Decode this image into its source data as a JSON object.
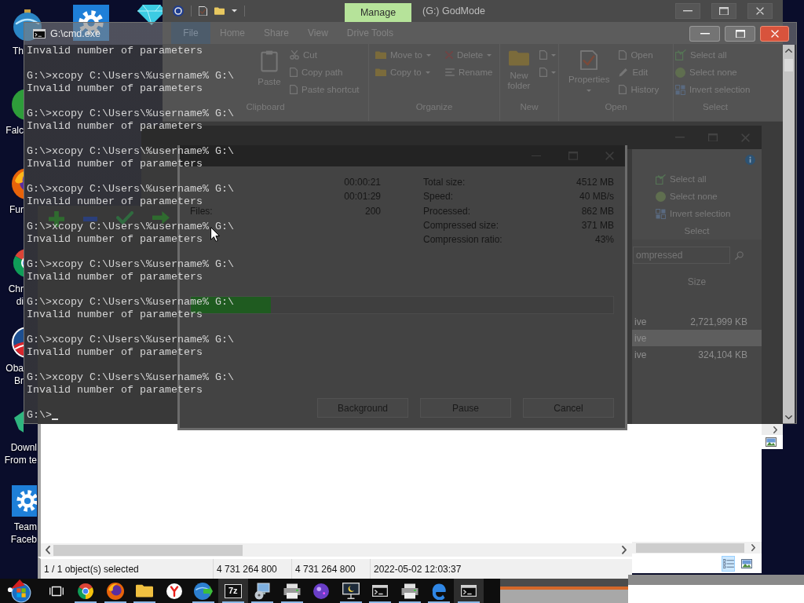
{
  "desktop_icons": [
    {
      "kind": "globe",
      "lines": [
        "Th"
      ]
    },
    {
      "kind": "sphere",
      "lines": [
        "Falc"
      ]
    },
    {
      "kind": "flame",
      "lines": [
        "Fur"
      ]
    },
    {
      "kind": "ring",
      "lines": [
        "Chr",
        "di"
      ]
    },
    {
      "kind": "striped",
      "lines": [
        "Oba",
        "Br"
      ]
    },
    {
      "kind": "emblem",
      "lines": [
        "Downl",
        "From te"
      ]
    },
    {
      "kind": "gear",
      "lines": [
        "Team",
        "Faceb"
      ]
    }
  ],
  "desktop_top_icons": [
    {
      "kind": "gear"
    },
    {
      "kind": "gem"
    }
  ],
  "explorer": {
    "title": "(G:) GodMode",
    "context_tab": "Manage",
    "file_tab": "File",
    "tabs": [
      "Home",
      "Share",
      "View",
      "Drive Tools"
    ],
    "ribbon": [
      {
        "name": "Clipboard",
        "columns": [
          {
            "kind": "large",
            "items": [
              {
                "label": "Paste",
                "dropdown": false
              }
            ]
          },
          {
            "kind": "small",
            "items": [
              {
                "label": "Cut",
                "dropdown": false
              },
              {
                "label": "Copy path",
                "dropdown": false
              },
              {
                "label": "Paste shortcut",
                "dropdown": false
              }
            ]
          }
        ]
      },
      {
        "name": "Organize",
        "columns": [
          {
            "kind": "small",
            "items": [
              {
                "label": "Move to",
                "dropdown": true
              },
              {
                "label": "Copy to",
                "dropdown": true
              }
            ]
          },
          {
            "kind": "small",
            "items": [
              {
                "label": "Delete",
                "dropdown": true
              },
              {
                "label": "Rename",
                "dropdown": false
              }
            ]
          }
        ]
      },
      {
        "name": "New",
        "columns": [
          {
            "kind": "large",
            "items": [
              {
                "label": "New folder",
                "dropdown": false
              }
            ]
          },
          {
            "kind": "small",
            "items": [
              {
                "dropdown": true
              },
              {
                "dropdown": true
              }
            ]
          }
        ]
      },
      {
        "name": "Open",
        "columns": [
          {
            "kind": "large",
            "items": [
              {
                "label": "Properties",
                "dropdown": true
              }
            ]
          },
          {
            "kind": "small",
            "items": [
              {
                "label": "Open",
                "dropdown": false
              },
              {
                "label": "Edit",
                "dropdown": false
              },
              {
                "label": "History",
                "dropdown": false
              }
            ]
          }
        ]
      },
      {
        "name": "Select",
        "columns": [
          {
            "kind": "small",
            "items": [
              {
                "label": "Select all",
                "dropdown": false
              },
              {
                "label": "Select none",
                "dropdown": false
              },
              {
                "label": "Invert selection",
                "dropdown": false
              }
            ]
          }
        ]
      }
    ]
  },
  "console": {
    "title": "G:\\cmd.exe",
    "first_output": "Invalid number of parameters",
    "entries": [
      {
        "command": "G:\\>xcopy C:\\Users\\%username% G:\\",
        "output": "Invalid number of parameters"
      },
      {
        "command": "G:\\>xcopy C:\\Users\\%username% G:\\",
        "output": "Invalid number of parameters"
      },
      {
        "command": "G:\\>xcopy C:\\Users\\%username% G:\\",
        "output": "Invalid number of parameters"
      },
      {
        "command": "G:\\>xcopy C:\\Users\\%username% G:\\",
        "output": "Invalid number of parameters"
      },
      {
        "command": "G:\\>xcopy C:\\Users\\%username% G:\\",
        "output": "Invalid number of parameters"
      },
      {
        "command": "G:\\>xcopy C:\\Users\\%username% G:\\",
        "output": "Invalid number of parameters"
      },
      {
        "command": "G:\\>xcopy C:\\Users\\%username% G:\\",
        "output": "Invalid number of parameters"
      },
      {
        "command": "G:\\>xcopy C:\\Users\\%username% G:\\",
        "output": "Invalid number of parameters"
      },
      {
        "command": "G:\\>xcopy C:\\Users\\%username% G:\\",
        "output": "Invalid number of parameters"
      }
    ],
    "prompt": "G:\\>"
  },
  "extract_dialog": {
    "left_stats": [
      {
        "value": "00:00:21"
      },
      {
        "value": "00:01:29"
      },
      {
        "label": "Files:",
        "value": "200"
      }
    ],
    "right_stats": [
      {
        "label": "Total size:",
        "value": "4512 MB"
      },
      {
        "label": "Speed:",
        "value": "40 MB/s"
      },
      {
        "label": "Processed:",
        "value": "862 MB"
      },
      {
        "label": "Compressed size:",
        "value": "371 MB"
      },
      {
        "label": "Compression ratio:",
        "value": "43%"
      }
    ],
    "progress": {
      "level": 0.19
    },
    "buttons": [
      "Background",
      "Pause",
      "Cancel"
    ]
  },
  "compressed_window": {
    "select_commands": [
      "Select all",
      "Select none",
      "Invert selection"
    ],
    "group": "Select",
    "search": {
      "placeholder": "ompressed"
    },
    "column": "Size",
    "rows": [
      {
        "name": "ive",
        "size": "2,721,999 KB",
        "selected": false
      },
      {
        "name": "ive",
        "selected": true
      },
      {
        "name": "ive",
        "size": "324,104 KB",
        "selected": false
      }
    ],
    "views": [
      {
        "kind": "details",
        "selected": true
      },
      {
        "kind": "large_icons",
        "selected": false
      }
    ]
  },
  "file_manager": {
    "status": [
      "1 / 1 object(s) selected",
      "4 731 264 800",
      "4 731 264 800",
      "2022-05-02 12:03:37"
    ]
  },
  "taskbar": {
    "items": [
      {
        "kind": "task_view",
        "running": false,
        "active": false
      },
      {
        "kind": "ring",
        "running": true,
        "active": false
      },
      {
        "kind": "flame",
        "running": true,
        "active": false
      },
      {
        "kind": "folder",
        "running": true,
        "active": false
      },
      {
        "kind": "yletter",
        "running": false,
        "active": false
      },
      {
        "kind": "globe",
        "running": true,
        "active": false
      },
      {
        "kind": "archive",
        "glyph": "7z",
        "running": true,
        "active": true
      },
      {
        "kind": "installer",
        "running": true,
        "active": false
      },
      {
        "kind": "printer",
        "running": true,
        "active": false
      },
      {
        "kind": "orb",
        "running": false,
        "active": false
      },
      {
        "kind": "monitor",
        "running": true,
        "active": false
      },
      {
        "kind": "terminal",
        "running": true,
        "active": false
      },
      {
        "kind": "printer",
        "running": true,
        "active": false
      },
      {
        "kind": "swirl",
        "running": true,
        "active": false
      },
      {
        "kind": "terminal",
        "running": true,
        "active": true
      }
    ]
  }
}
